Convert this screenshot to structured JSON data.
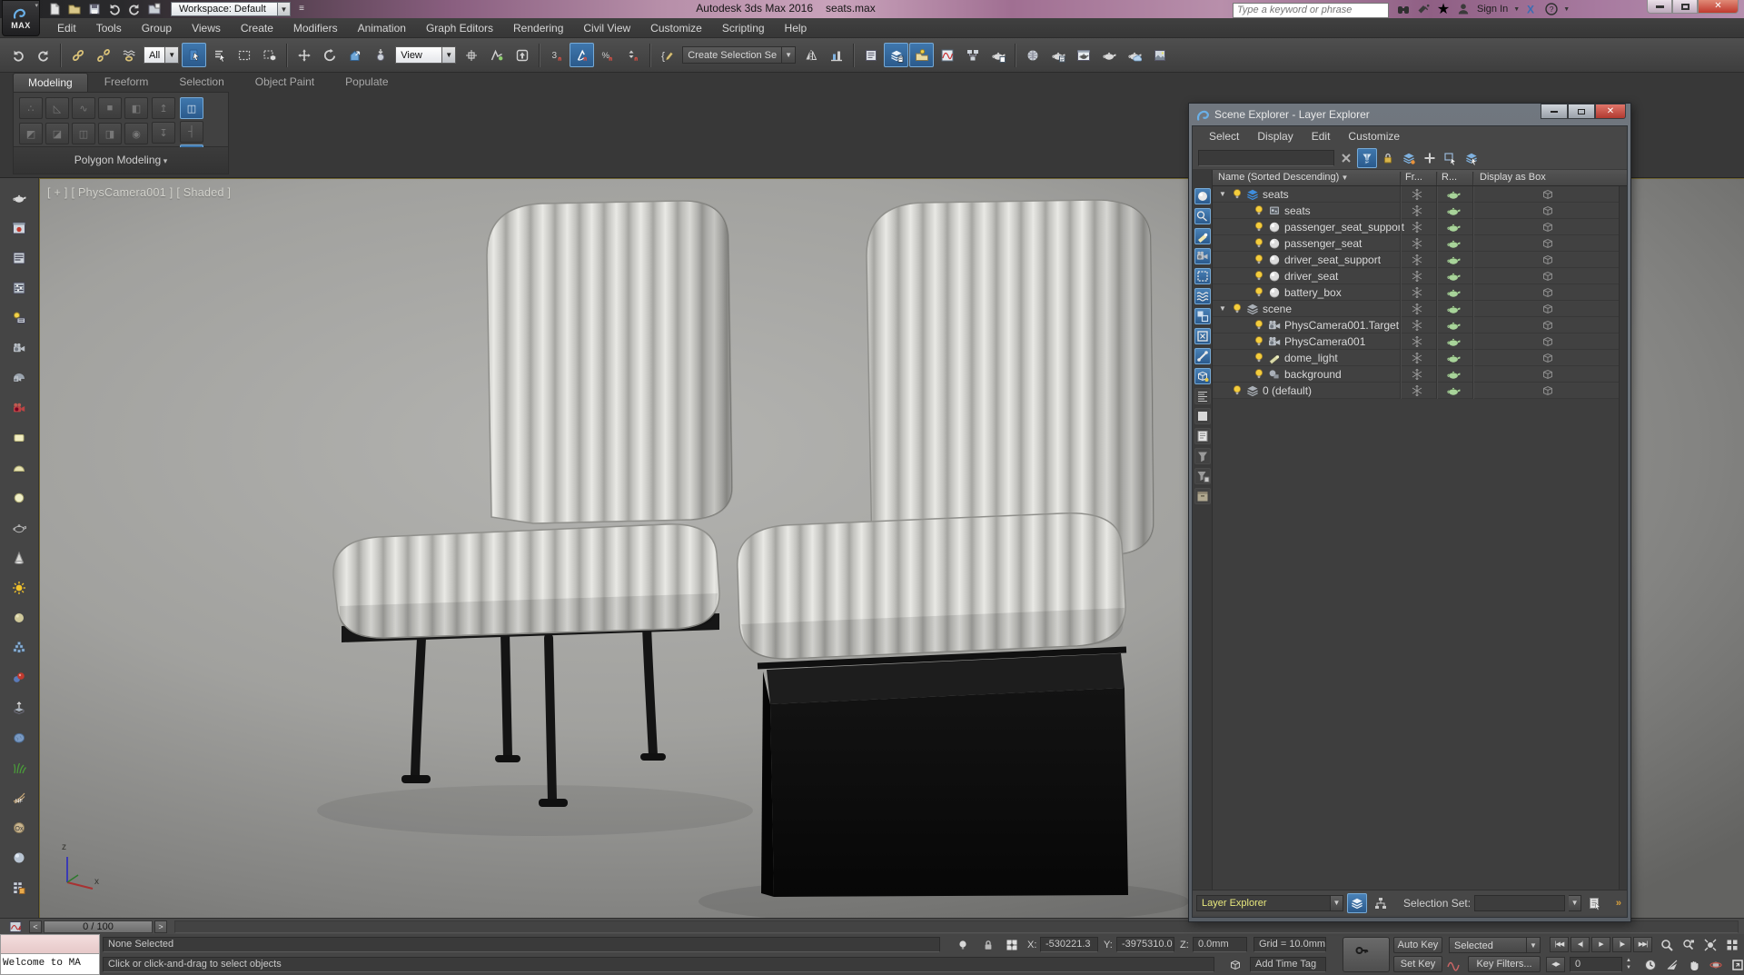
{
  "window": {
    "app_title": "Autodesk 3ds Max 2016",
    "doc_title": "seats.max",
    "workspace_label": "Workspace: Default",
    "search_placeholder": "Type a keyword or phrase",
    "sign_in_label": "Sign In",
    "logo_label": "MAX"
  },
  "menu_bar": {
    "items": [
      "Edit",
      "Tools",
      "Group",
      "Views",
      "Create",
      "Modifiers",
      "Animation",
      "Graph Editors",
      "Rendering",
      "Civil View",
      "Customize",
      "Scripting",
      "Help"
    ]
  },
  "quick_access": [
    "new-file-icon",
    "open-file-icon",
    "save-file-icon",
    "undo-icon",
    "redo-icon",
    "project-folder-icon"
  ],
  "title_icons": [
    "search-binoculars-icon",
    "communication-center-icon",
    "favorites-star-icon",
    "user-icon"
  ],
  "main_toolbar": {
    "selection_filter_value": "All",
    "coord_system_value": "View",
    "named_selection_value": "Create Selection Se",
    "g1": [
      "undo-icon",
      "redo-icon"
    ],
    "g2": [
      "select-and-link-icon",
      "unlink-selection-icon",
      "bind-to-spacewarp-icon"
    ],
    "g3": [
      "select-object-icon",
      "select-by-name-icon"
    ],
    "g3b": [
      "rectangular-selection-icon",
      "window-crossing-icon"
    ],
    "g4": [
      "select-and-move-icon",
      "select-and-rotate-icon",
      "select-and-scale-icon",
      "select-and-place-icon"
    ],
    "g5": [
      "use-pivot-center-icon",
      "select-and-manipulate-icon",
      "keyboard-override-icon"
    ],
    "g6": [
      "snaps-toggle-icon",
      "angle-snap-icon",
      "percent-snap-icon",
      "spinner-snap-icon"
    ],
    "g7": [
      "edit-named-sets-icon"
    ],
    "g8": [
      "mirror-icon",
      "align-icon"
    ],
    "g9": [
      "layer-manager-icon",
      "scene-explorer-toggle-icon",
      "layer-explorer-toggle-icon",
      "curve-editor-icon",
      "schematic-view-icon",
      "render-setup-flyout-icon"
    ],
    "g10": [
      "material-editor-icon",
      "render-setup-icon",
      "rendered-frame-icon",
      "render-production-icon",
      "render-cloud-icon",
      "render-last-icon"
    ],
    "active": [
      "select-object-icon",
      "angle-snap-icon",
      "scene-explorer-toggle-icon",
      "layer-explorer-toggle-icon"
    ]
  },
  "ribbon": {
    "tabs": [
      "Modeling",
      "Freeform",
      "Selection",
      "Object Paint",
      "Populate"
    ],
    "active_tab": "Modeling",
    "panel_label": "Polygon Modeling"
  },
  "left_toolbar": [
    "render-flyout-icon",
    "rendered-frame-window-icon",
    "render-setup-dialog-icon",
    "exposure-control-icon",
    "light-lister-icon",
    "film-camera-icon",
    "viewport-camera-icon",
    "physical-camera-icon",
    "rect-light-icon",
    "dome-light-icon",
    "disc-light-icon",
    "wire-teapot-icon",
    "spot-light-icon",
    "sun-light-icon",
    "sphere-light-icon",
    "scatter-icon",
    "particle-icon",
    "camera-map-icon",
    "rock-icon",
    "grass-icon",
    "hair-fur-icon",
    "ornatrix-icon",
    "sphere-icon",
    "slate-editor-icon"
  ],
  "viewport": {
    "label": "[ + ] [ PhysCamera001 ] [ Shaded ]",
    "axis_x": "x",
    "axis_z": "z"
  },
  "scene_explorer": {
    "title": "Scene Explorer - Layer Explorer",
    "menus": [
      "Select",
      "Display",
      "Edit",
      "Customize"
    ],
    "tool_icons": [
      "clear-search-icon",
      "display-filter-icon",
      "lock-cell-edit-icon",
      "prune-scene-icon",
      "add-new-layer-icon",
      "pick-parent-icon",
      "select-children-icon"
    ],
    "tool_active": [
      "display-filter-icon"
    ],
    "side_icons": [
      "display-geometry-icon",
      "display-shapes-icon",
      "display-lights-icon",
      "display-cameras-icon",
      "display-helpers-icon",
      "display-spacewarps-icon",
      "display-groups-icon",
      "display-xrefs-icon",
      "display-bones-icon",
      "display-containers-icon",
      "expand-all-icon",
      "collapse-all-icon",
      "pick-list-icon",
      "filter-list-icon",
      "filter-add-icon",
      "archive-icon"
    ],
    "side_active": [
      "display-geometry-icon",
      "display-shapes-icon",
      "display-lights-icon",
      "display-cameras-icon",
      "display-helpers-icon",
      "display-spacewarps-icon",
      "display-groups-icon",
      "display-xrefs-icon",
      "display-bones-icon",
      "display-containers-icon"
    ],
    "columns": {
      "name": "Name (Sorted Descending)",
      "frozen": "Fr...",
      "render": "R...",
      "display": "Display as Box"
    },
    "rows": [
      {
        "label": "seats",
        "icon": "layer-current-icon",
        "level": 0,
        "expanded": true
      },
      {
        "label": "seats",
        "icon": "geometry-group-icon",
        "level": 1
      },
      {
        "label": "passenger_seat_support",
        "icon": "object-sphere-icon",
        "level": 1
      },
      {
        "label": "passenger_seat",
        "icon": "object-sphere-icon",
        "level": 1
      },
      {
        "label": "driver_seat_support",
        "icon": "object-sphere-icon",
        "level": 1
      },
      {
        "label": "driver_seat",
        "icon": "object-sphere-icon",
        "level": 1
      },
      {
        "label": "battery_box",
        "icon": "object-sphere-icon",
        "level": 1
      },
      {
        "label": "scene",
        "icon": "layer-icon",
        "level": 0,
        "expanded": true
      },
      {
        "label": "PhysCamera001.Target",
        "icon": "camera-icon",
        "level": 1
      },
      {
        "label": "PhysCamera001",
        "icon": "camera-icon",
        "level": 1
      },
      {
        "label": "dome_light",
        "icon": "light-icon",
        "level": 1
      },
      {
        "label": "background",
        "icon": "helper-icon",
        "level": 1
      },
      {
        "label": "0 (default)",
        "icon": "layer-icon",
        "level": 0
      }
    ],
    "footer": {
      "mode_value": "Layer Explorer",
      "selection_set_label": "Selection Set:",
      "chevrons": "»"
    }
  },
  "timeline": {
    "frame_display": "0 / 100",
    "prev_glyph": "<",
    "next_glyph": ">"
  },
  "status_bar": {
    "listener_text": "Welcome to MA",
    "selection_status": "None Selected",
    "prompt": "Click or click-and-drag to select objects",
    "x_label": "X:",
    "x_value": "-530221.3",
    "y_label": "Y:",
    "y_value": "-3975310.0",
    "z_label": "Z:",
    "z_value": "0.0mm",
    "grid_label": "Grid = 10.0mm",
    "add_time_tag": "Add Time Tag",
    "auto_key": "Auto Key",
    "set_key": "Set Key",
    "key_mode_value": "Selected",
    "key_filters": "Key Filters...",
    "frame_value": "0",
    "playback": [
      "go-start-icon",
      "prev-frame-icon",
      "play-icon",
      "next-frame-icon",
      "go-end-icon"
    ],
    "nav_top": [
      "zoom-icon",
      "zoom-all-icon",
      "zoom-extents-icon",
      "zoom-extents-all-icon"
    ],
    "nav_bottom": [
      "time-config-icon",
      "zoom-region-icon",
      "pan-icon",
      "orbit-icon",
      "maximize-viewport-icon"
    ]
  }
}
